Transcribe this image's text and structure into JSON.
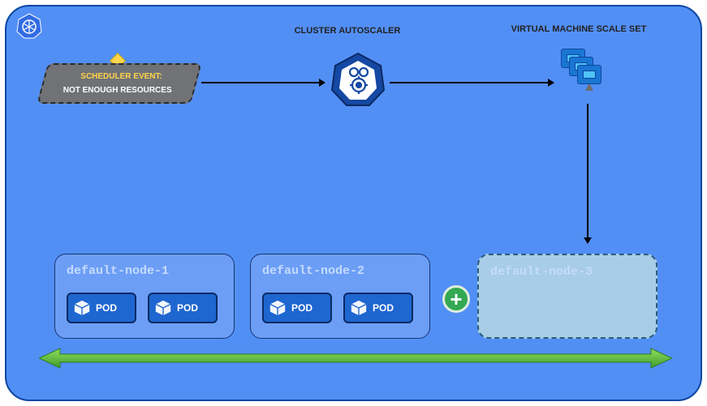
{
  "labels": {
    "autoscaler": "CLUSTER AUTOSCALER",
    "vmss": "VIRTUAL MACHINE SCALE SET"
  },
  "scheduler_event": {
    "line1": "SCHEDULER EVENT:",
    "line2": "NOT ENOUGH RESOURCES"
  },
  "nodes": {
    "n1": "default-node-1",
    "n2": "default-node-2",
    "n3": "default-node-3"
  },
  "pod_label": "POD",
  "plus": "+"
}
